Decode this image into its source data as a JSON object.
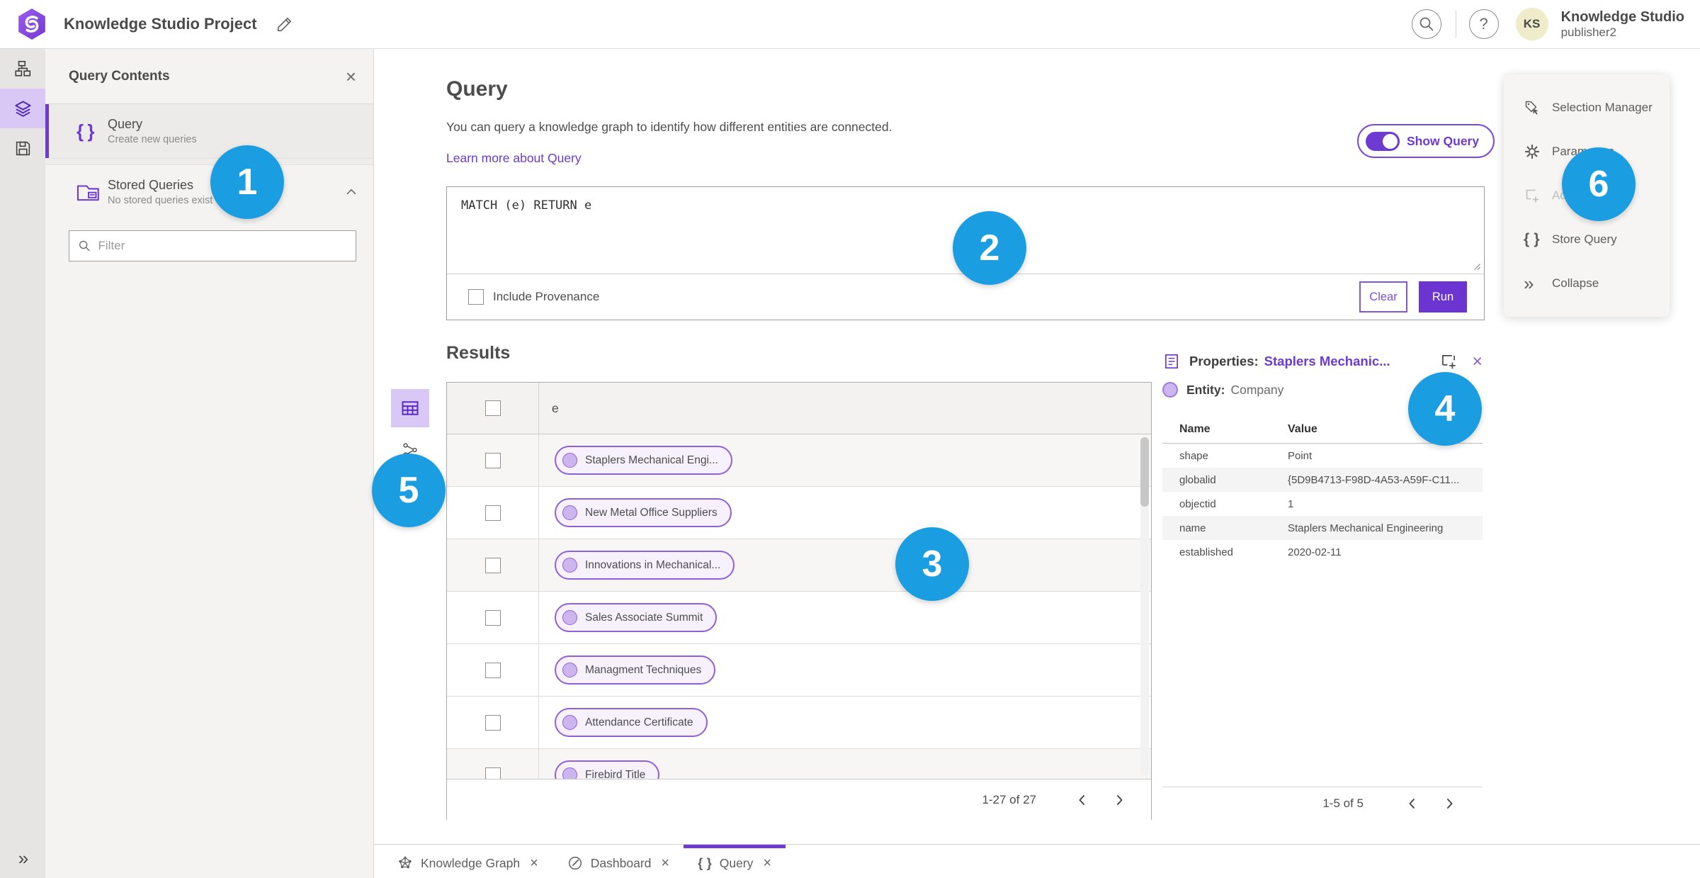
{
  "header": {
    "app_title": "Knowledge Studio Project",
    "user_name": "Knowledge Studio",
    "user_role": "publisher2",
    "avatar_initials": "KS"
  },
  "contents_panel": {
    "title": "Query Contents",
    "query_item": {
      "label": "Query",
      "description": "Create new queries"
    },
    "stored_item": {
      "label": "Stored Queries",
      "description": "No stored queries exist"
    },
    "filter_placeholder": "Filter"
  },
  "query_section": {
    "title": "Query",
    "description": "You can query a knowledge graph to identify how different entities are connected.",
    "learn_more_label": "Learn more about Query",
    "show_query_label": "Show Query",
    "show_query_on": true,
    "query_text": "MATCH (e) RETURN e",
    "include_provenance_label": "Include Provenance",
    "include_provenance_checked": false,
    "clear_label": "Clear",
    "run_label": "Run"
  },
  "results": {
    "title": "Results",
    "column_header": "e",
    "rows": [
      "Staplers Mechanical Engi...",
      "New Metal Office Suppliers",
      "Innovations in Mechanical...",
      "Sales Associate Summit",
      "Managment Techniques",
      "Attendance Certificate",
      "Firebird Title"
    ],
    "pagination": "1-27 of 27"
  },
  "properties": {
    "title": "Properties:",
    "entity_link": "Staplers Mechanic...",
    "entity_label": "Entity:",
    "entity_type": "Company",
    "col_name": "Name",
    "col_value": "Value",
    "rows": [
      {
        "name": "shape",
        "value": "Point"
      },
      {
        "name": "globalid",
        "value": "{5D9B4713-F98D-4A53-A59F-C11..."
      },
      {
        "name": "objectid",
        "value": "1"
      },
      {
        "name": "name",
        "value": "Staplers Mechanical Engineering"
      },
      {
        "name": "established",
        "value": "2020-02-11"
      }
    ],
    "pagination": "1-5 of 5"
  },
  "right_menu": {
    "items": [
      {
        "label": "Selection Manager"
      },
      {
        "label": "Parameters"
      },
      {
        "label": "Ad",
        "disabled": true
      },
      {
        "label": "Store Query"
      },
      {
        "label": "Collapse"
      }
    ]
  },
  "tab_bar": {
    "tabs": [
      {
        "label": "Knowledge Graph"
      },
      {
        "label": "Dashboard"
      },
      {
        "label": "Query",
        "active": true
      }
    ]
  },
  "badges": [
    "1",
    "2",
    "3",
    "4",
    "5",
    "6"
  ],
  "colors": {
    "accent_purple": "#6d3ad2",
    "badge_blue": "#1b9de2",
    "chip_border": "#8d62d9",
    "chip_fill": "#f6f1fd",
    "active_highlight": "#d9c7f6",
    "avatar_bg": "#eeeccb"
  }
}
